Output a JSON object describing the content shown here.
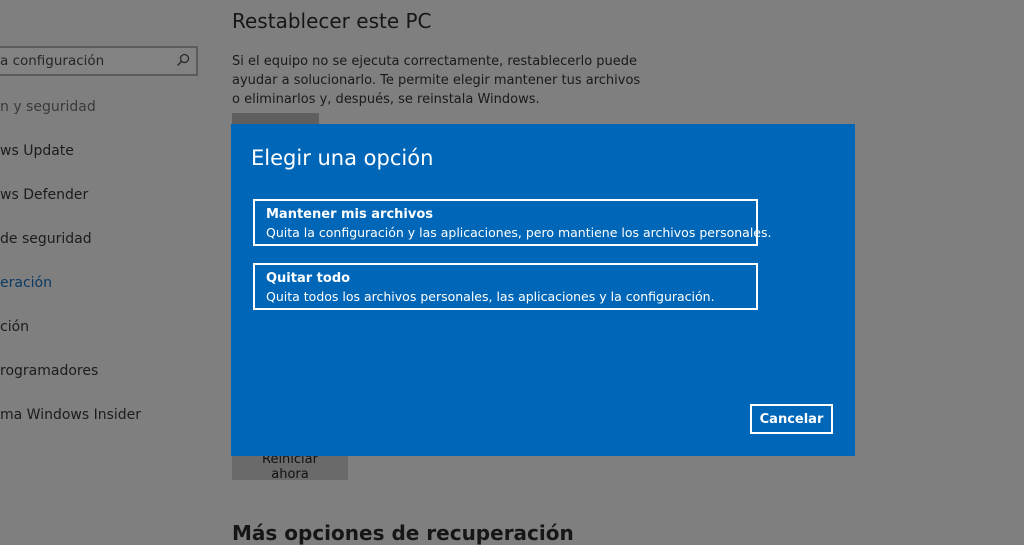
{
  "sidebar": {
    "search": {
      "placeholder": "a configuración",
      "icon": "search-icon"
    },
    "items": [
      {
        "label": "n y seguridad"
      },
      {
        "label": "ws Update"
      },
      {
        "label": "ws Defender"
      },
      {
        "label": "de seguridad"
      },
      {
        "label": "eración"
      },
      {
        "label": "ción"
      },
      {
        "label": "rogramadores"
      },
      {
        "label": "ma Windows Insider"
      }
    ]
  },
  "main": {
    "title": "Restablecer este PC",
    "description": "Si el equipo no se ejecuta correctamente, restablecerlo puede ayudar a solucionarlo. Te permite elegir mantener tus archivos o eliminarlos y, después, se reinstala Windows.",
    "restart_button": "Reiniciar ahora",
    "more_options_title": "Más opciones de recuperación"
  },
  "dialog": {
    "title": "Elegir una opción",
    "options": [
      {
        "title": "Mantener mis archivos",
        "description": "Quita la configuración y las aplicaciones, pero mantiene los archivos personales."
      },
      {
        "title": "Quitar todo",
        "description": "Quita todos los archivos personales, las aplicaciones y la configuración."
      }
    ],
    "cancel_label": "Cancelar"
  },
  "colors": {
    "dialog_background": "#0067b8",
    "overlay_background": "#7f7f7f",
    "active_nav": "#0b3a63"
  }
}
